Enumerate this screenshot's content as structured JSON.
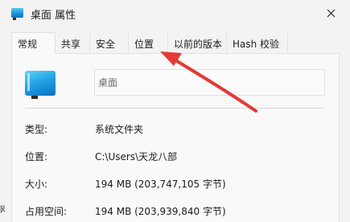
{
  "window": {
    "title": "桌面 属性",
    "close_icon": "close-icon",
    "folder_icon": "desktop-folder-icon"
  },
  "tabs": [
    {
      "label": "常规",
      "active": true
    },
    {
      "label": "共享",
      "active": false
    },
    {
      "label": "安全",
      "active": false
    },
    {
      "label": "位置",
      "active": false
    },
    {
      "label": "以前的版本",
      "active": false
    },
    {
      "label": "Hash 校验",
      "active": false
    }
  ],
  "general": {
    "name_value": "桌面",
    "properties": [
      {
        "label": "类型:",
        "value": "系统文件夹"
      },
      {
        "label": "位置:",
        "value": "C:\\Users\\天龙八部"
      },
      {
        "label": "大小:",
        "value": "194 MB (203,747,105 字节)"
      },
      {
        "label": "占用空间:",
        "value": "194 MB (203,939,840 字节)"
      }
    ]
  },
  "edge_text": "网",
  "colors": {
    "annotation_arrow": "#e53935",
    "window_bg": "#f3f3f3",
    "panel_bg": "#f9f9f9"
  }
}
